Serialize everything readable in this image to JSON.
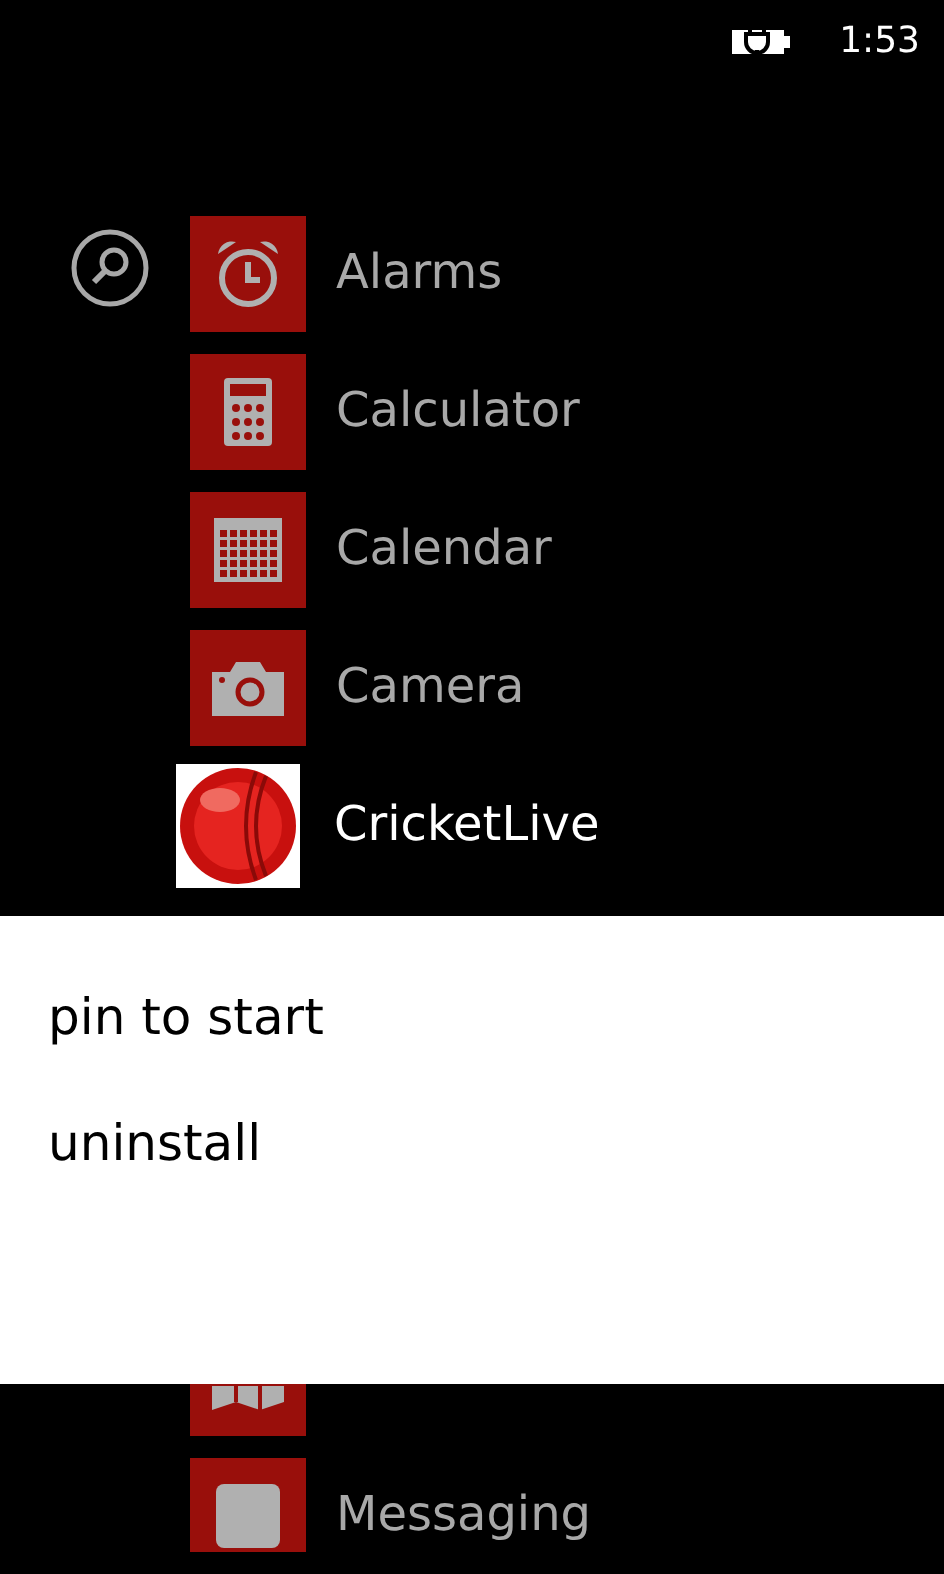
{
  "status_bar": {
    "time": "1:53"
  },
  "apps": [
    {
      "name": "Alarms",
      "kind": "tile",
      "selected": false
    },
    {
      "name": "Calculator",
      "kind": "tile",
      "selected": false
    },
    {
      "name": "Calendar",
      "kind": "tile",
      "selected": false
    },
    {
      "name": "Camera",
      "kind": "tile",
      "selected": false
    },
    {
      "name": "CricketLive",
      "kind": "picture",
      "selected": true
    }
  ],
  "context_menu": {
    "items": [
      "pin to start",
      "uninstall"
    ]
  },
  "apps_below": [
    {
      "kind": "tile",
      "selected": false
    },
    {
      "name": "Messaging",
      "kind": "tile",
      "selected": false
    }
  ]
}
